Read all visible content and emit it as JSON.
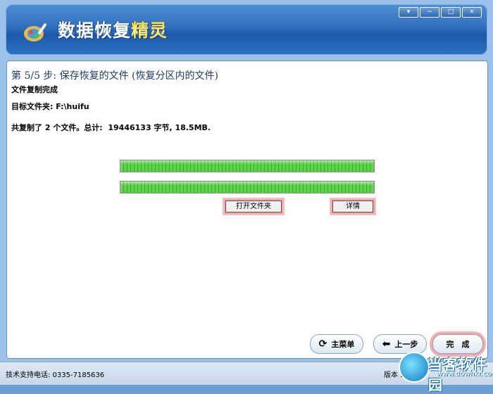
{
  "header": {
    "title_main": "数据恢复",
    "title_accent": "精灵",
    "controls": [
      "▾",
      "−",
      "□",
      "×"
    ]
  },
  "step": {
    "title": "第 5/5 步: 保存恢复的文件 (恢复分区内的文件)",
    "status": "文件复制完成",
    "target": "目标文件夹: F:\\huifu",
    "summary": "共复制了 2 个文件。总计:  19446133 字节, 18.5MB."
  },
  "progress": [
    1.0,
    1.0
  ],
  "buttons": {
    "open_folder": "打开文件夹",
    "details": "详情",
    "main_menu": "主菜单",
    "prev": "上一步",
    "finish": "完　成"
  },
  "icons": {
    "main_menu": "refresh-icon",
    "prev": "back-arrow-icon"
  },
  "statusbar": {
    "support": "技术支持电话: 0335-7185636",
    "version": "版本 3.",
    "watermark": "当客软件园",
    "watermark_url": "www.downkr.com"
  },
  "colors": {
    "accent": "#ffe24a",
    "progress": "#5ed24b",
    "highlight": "#f3a4a4"
  }
}
